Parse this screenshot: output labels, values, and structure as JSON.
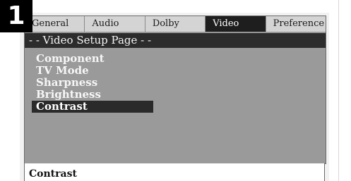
{
  "step_number": "1",
  "tabs": [
    {
      "label": "General"
    },
    {
      "label": "Audio"
    },
    {
      "label": "Dolby"
    },
    {
      "label": "Video",
      "active": true
    },
    {
      "label": "Preference"
    }
  ],
  "page_title": "- - Video Setup Page - -",
  "menu": {
    "items": [
      {
        "label": "Component"
      },
      {
        "label": "TV Mode"
      },
      {
        "label": "Sharpness"
      },
      {
        "label": "Brightness"
      },
      {
        "label": "Contrast",
        "selected": true
      }
    ]
  },
  "help_text": "Contrast",
  "colors": {
    "osd_background": "#9a9a9a",
    "highlight": "#2a2a2a",
    "badge": "#000000"
  }
}
